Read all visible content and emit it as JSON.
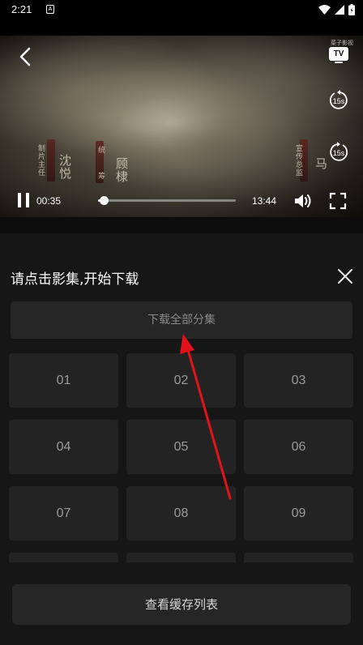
{
  "status_bar": {
    "time": "2:21",
    "notification_badge": "A",
    "icons": [
      "wifi-icon",
      "signal-icon",
      "battery-icon"
    ]
  },
  "player": {
    "current_time": "00:35",
    "total_time": "13:44",
    "progress_fraction": 0.042,
    "tv_label": "TV",
    "rewind_label": "15s",
    "forward_label": "15s",
    "watermark": "菜子影视",
    "calligraphy": [
      "沈悦",
      "顾棣",
      "马",
      "编剧",
      "制片主任",
      "宣传总监",
      "统",
      "筹"
    ]
  },
  "panel": {
    "title": "请点击影集,开始下载",
    "download_all_label": "下载全部分集",
    "episodes": [
      "01",
      "02",
      "03",
      "04",
      "05",
      "06",
      "07",
      "08",
      "09",
      "",
      "",
      ""
    ],
    "cache_list_label": "查看缓存列表"
  },
  "colors": {
    "panel_bg": "#161616",
    "button_bg": "#262626",
    "arrow": "#e0131b"
  }
}
